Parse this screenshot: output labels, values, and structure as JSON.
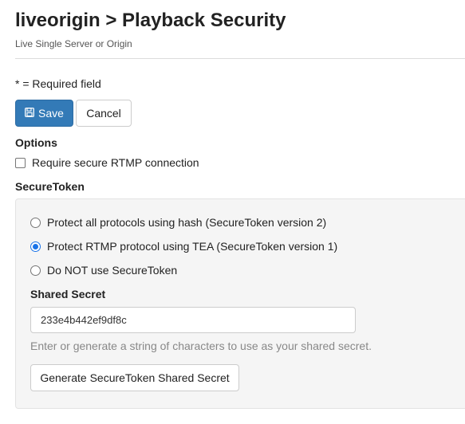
{
  "header": {
    "title": "liveorigin > Playback Security",
    "subtitle": "Live Single Server or Origin"
  },
  "form": {
    "required_note": "* = Required field",
    "save_label": "Save",
    "cancel_label": "Cancel"
  },
  "options": {
    "heading": "Options",
    "require_secure_rtmp": {
      "label": "Require secure RTMP connection",
      "checked": false
    }
  },
  "securetoken": {
    "heading": "SecureToken",
    "radios": [
      {
        "label": "Protect all protocols using hash (SecureToken version 2)",
        "checked": false
      },
      {
        "label": "Protect RTMP protocol using TEA (SecureToken version 1)",
        "checked": true
      },
      {
        "label": "Do NOT use SecureToken",
        "checked": false
      }
    ],
    "shared_secret_label": "Shared Secret",
    "shared_secret_value": "233e4b442ef9df8c",
    "help_text": "Enter or generate a string of characters to use as your shared secret.",
    "generate_label": "Generate SecureToken Shared Secret"
  },
  "colors": {
    "primary": "#337ab7",
    "radio_checked": "#1a73e8"
  },
  "icons": {
    "save": "floppy-disk-icon"
  }
}
